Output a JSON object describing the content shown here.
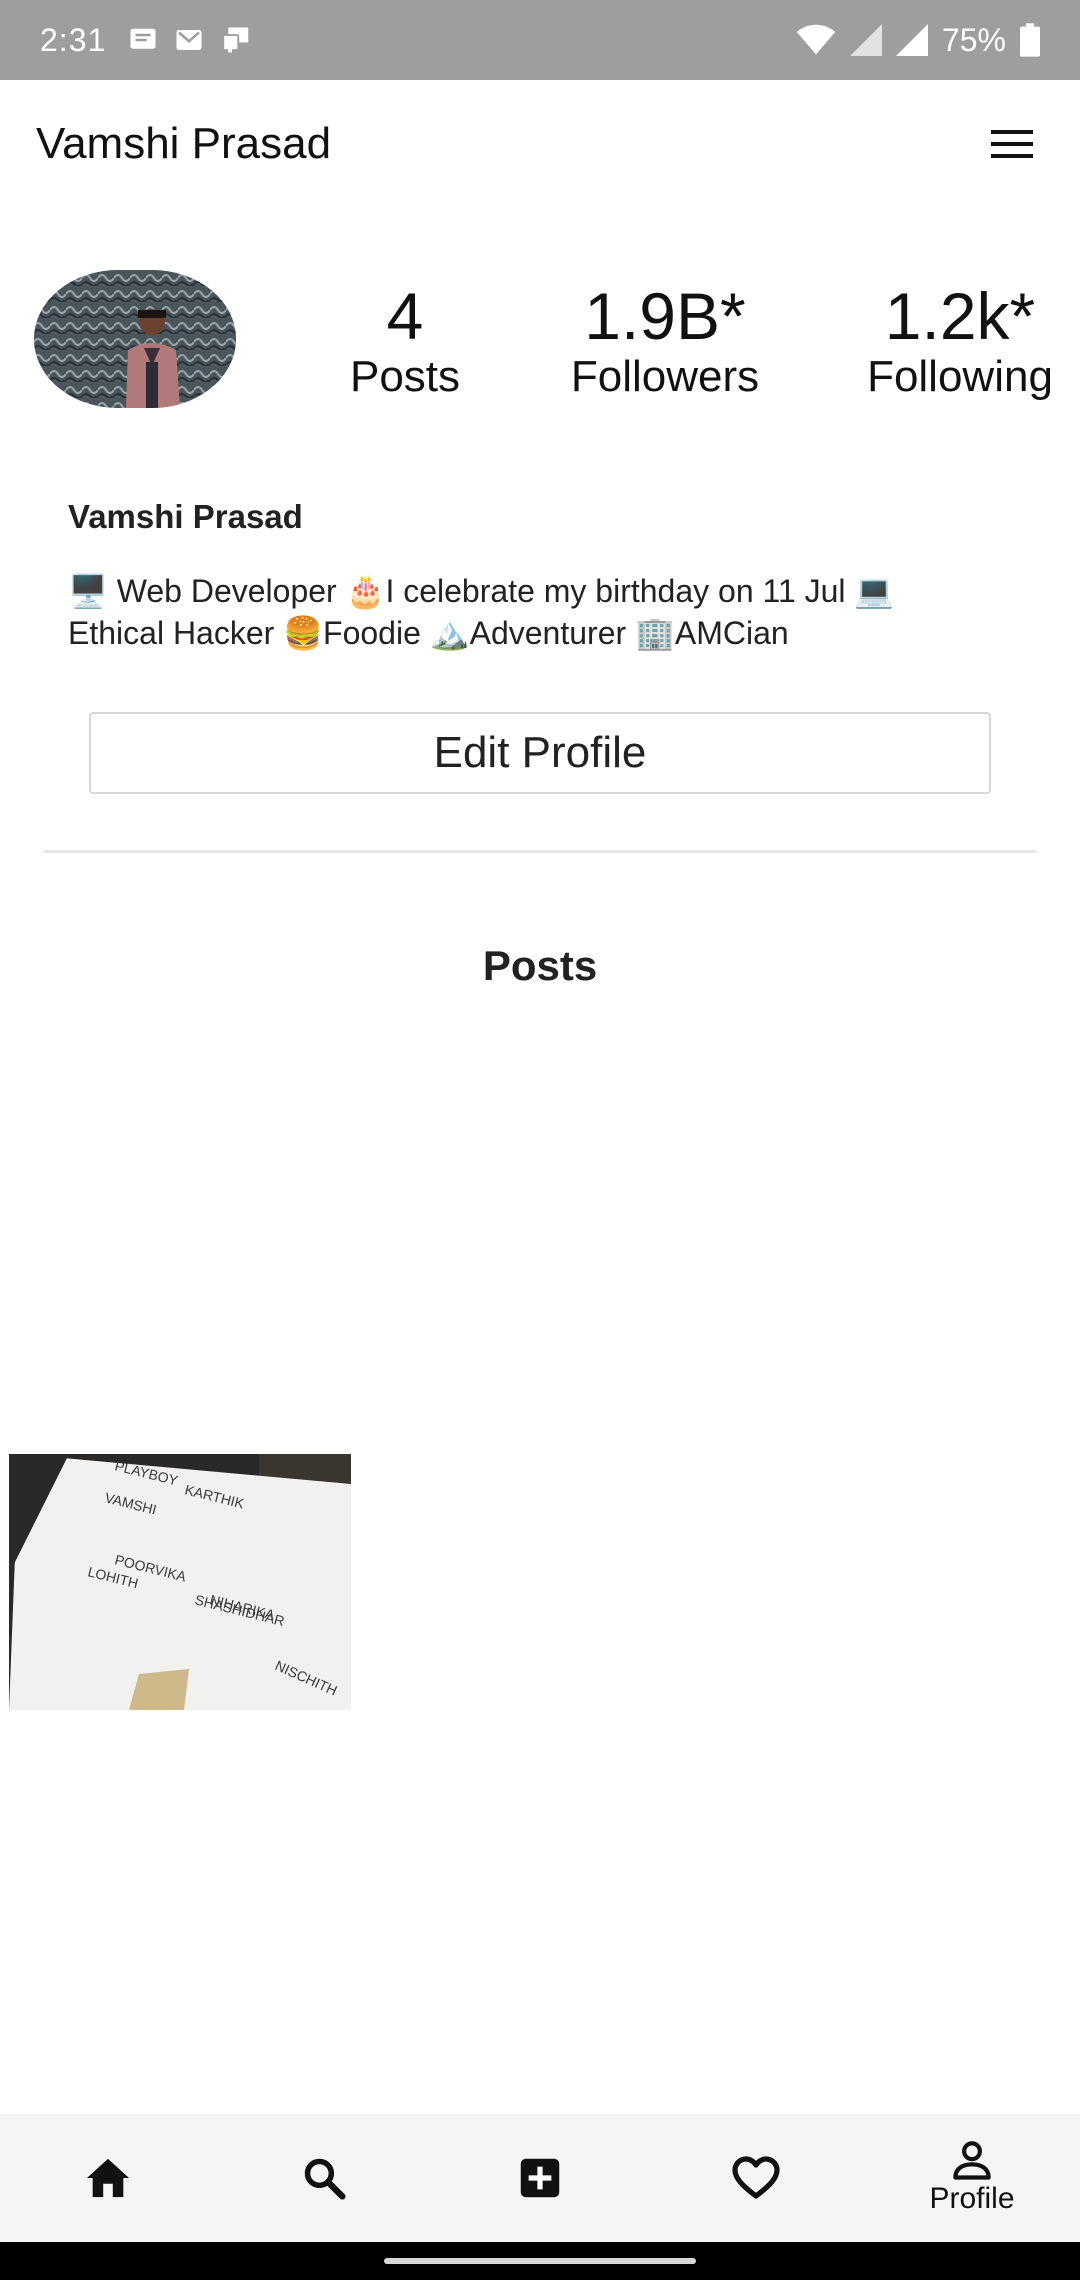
{
  "status_bar": {
    "time": "2:31",
    "battery": "75%"
  },
  "header": {
    "title": "Vamshi Prasad"
  },
  "stats": {
    "posts_value": "4",
    "posts_label": "Posts",
    "followers_value": "1.9B*",
    "followers_label": "Followers",
    "following_value": "1.2k*",
    "following_label": "Following"
  },
  "bio": {
    "name": "Vamshi Prasad",
    "text": "🖥️ Web Developer 🎂I celebrate my birthday on 11 Jul 💻 Ethical Hacker 🍔Foodie 🏔️Adventurer 🏢AMCian"
  },
  "edit_profile_label": "Edit Profile",
  "posts_section_title": "Posts",
  "post_image_words": [
    "PLAYBOY",
    "KARTHIK",
    "VAMSHI",
    "POORVIKA",
    "NIHARIKA",
    "SHASHIDHAR",
    "NISCHITH",
    "LOHITH"
  ],
  "bottom_nav": {
    "profile_label": "Profile"
  }
}
